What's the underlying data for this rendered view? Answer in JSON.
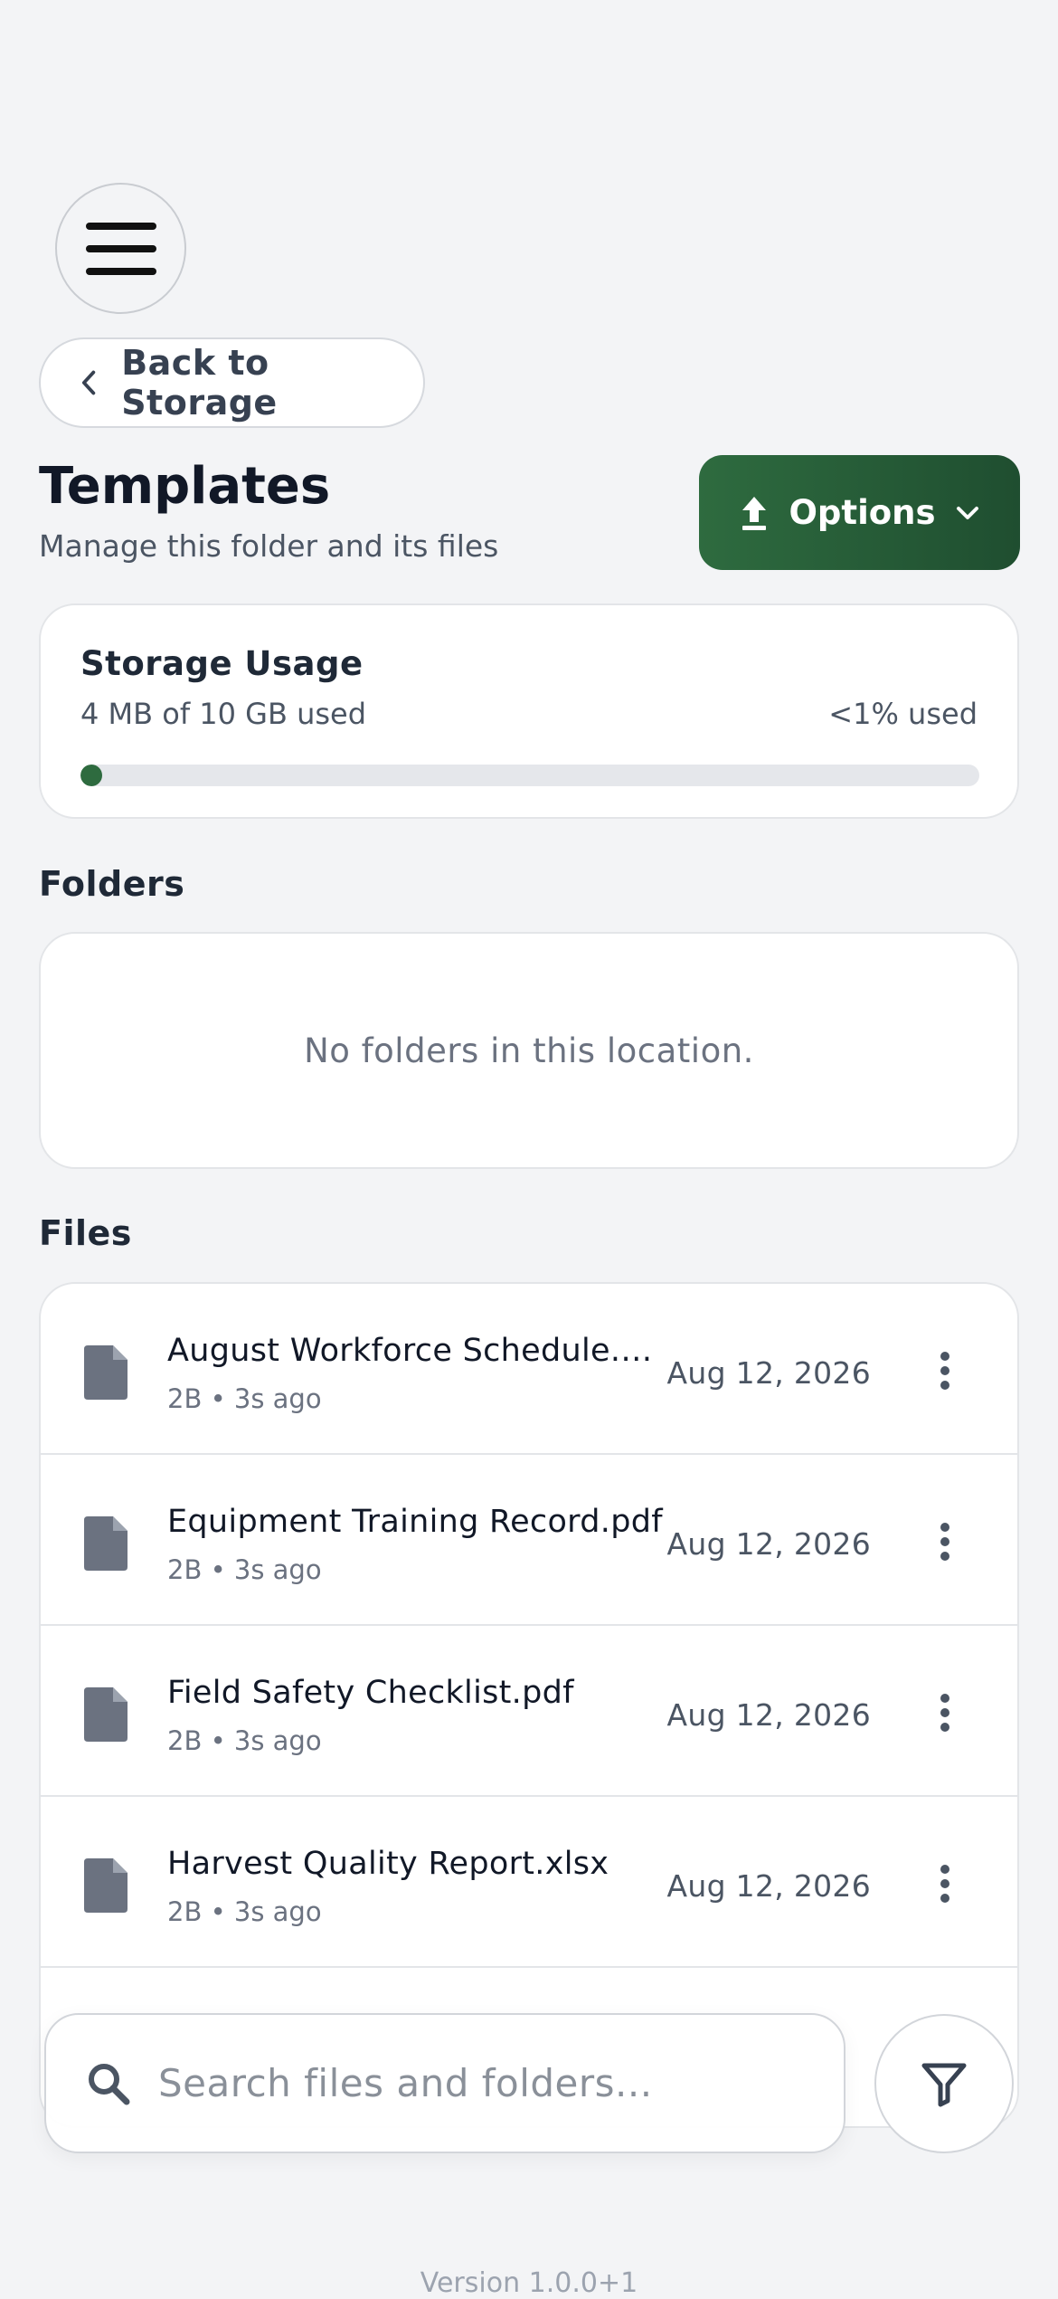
{
  "header": {
    "menu_icon": "hamburger-icon",
    "back_label": "Back to Storage",
    "back_icon": "chevron-left-icon"
  },
  "folder": {
    "title": "Templates",
    "subtitle": "Manage this folder and its files"
  },
  "options_button": {
    "label": "Options",
    "icon": "upload-icon",
    "chevron": "chevron-down-icon",
    "color": "#2e6b3f"
  },
  "storage": {
    "title": "Storage Usage",
    "used_text": "4 MB of 10 GB used",
    "percent_text": "<1% used",
    "percent_value": 0.04
  },
  "folders_section": {
    "label": "Folders",
    "empty_text": "No folders in this location."
  },
  "files_section": {
    "label": "Files",
    "files": [
      {
        "name": "August Workforce Schedule.docx",
        "meta": "2B • 3s ago",
        "date": "Aug 12, 2026"
      },
      {
        "name": "Equipment Training Record.pdf",
        "meta": "2B • 3s ago",
        "date": "Aug 12, 2026"
      },
      {
        "name": "Field Safety Checklist.pdf",
        "meta": "2B • 3s ago",
        "date": "Aug 12, 2026"
      },
      {
        "name": "Harvest Quality Report.xlsx",
        "meta": "2B • 3s ago",
        "date": "Aug 12, 2026"
      }
    ]
  },
  "search": {
    "placeholder": "Search files and folders...",
    "value": ""
  },
  "filter_icon": "filter-icon",
  "footer": {
    "version": "Version 1.0.0+1"
  }
}
